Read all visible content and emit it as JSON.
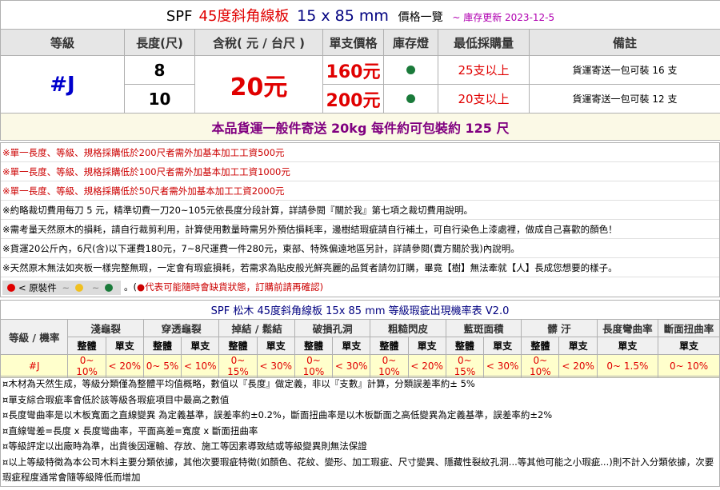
{
  "title": {
    "spf": "SPF",
    "name": "45度斜角線板",
    "size": "15 x 85 mm",
    "price_label": "價格一覽",
    "updated": "~ 庫存更新 2023-12-5"
  },
  "headers": [
    "等級",
    "長度(尺)",
    "含稅( 元 / 台尺 )",
    "單支價格",
    "庫存燈",
    "最低採購量",
    "備註"
  ],
  "grade": "#J",
  "tax_price": "20元",
  "rows": [
    {
      "length": "8",
      "unit_price": "160元",
      "stock_color": "#1a7a3a",
      "min_buy": "25支以上",
      "remark": "貨運寄送一包可裝 16 支"
    },
    {
      "length": "10",
      "unit_price": "200元",
      "stock_color": "#1a7a3a",
      "min_buy": "20支以上",
      "remark": "貨運寄送一包可裝 12 支"
    }
  ],
  "shipping": "本品貨運一般件寄送 20kg 每件約可包裝約 125 尺",
  "notes": [
    "※單一長度、等級、規格採購低於200尺者需外加基本加工工資500元",
    "※單一長度、等級、規格採購低於100尺者需外加基本加工工資1000元",
    "※單一長度、等級、規格採購低於50尺者需外加基本加工工資2000元",
    "※約略裁切費用每刀 5 元，精準切費一刀20~105元依長度分段計算，詳請參閱『關於我』第七項之裁切費用說明。",
    "※需考量天然原木的損耗，請自行裁剪利用，計算使用數量時需另外預估損耗率，邊樹結瑕疵請自行補土，可自行染色上漆處裡，做成自己喜歡的顏色！",
    "※貨運20公斤內，6尺(含)以下運費180元，7~8尺運費一件280元，東部、特殊偏遠地區另計，詳請參閱(賣方關於我)內說明。",
    "※天然原木無法如夾板一樣完整無瑕，一定會有瑕疵損耗，若需求為貼皮般光鮮亮麗的品質者請勿訂購，畢竟【樹】無法牽就【人】長成您想要的樣子。"
  ],
  "notes_red_parts": {
    "n0": "※單一長度、等級、規格採購低於200尺者需外加基本加工工資500元",
    "n5_prefix": "※貨運20公斤內，"
  },
  "legend": {
    "label": "< 原裝件",
    "tilde": "~",
    "dot_colors": [
      "#e00000",
      "#f0c020",
      "#f0a0c0",
      "#1a7a3a"
    ],
    "suffix_open": "。(",
    "warning": "●代表可能隨時會缺貨狀態，訂購前請再確認)"
  },
  "defect": {
    "title": "SPF 松木 45度斜角線板  15x 85 mm 等級瑕疵出現機率表 V2.0",
    "grade_header": "等級 / 機率",
    "categories": [
      "淺龜裂",
      "穿透龜裂",
      "掉結 / 鬆結",
      "破損孔洞",
      "粗糙閃皮",
      "藍斑面積",
      "髒 汙",
      "長度彎曲率",
      "斷面扭曲率"
    ],
    "sub_whole": "整體",
    "sub_single": "單支",
    "row_grade": "#J",
    "values": [
      "0~ 10%",
      "< 20%",
      "0~ 5%",
      "< 10%",
      "0~ 15%",
      "< 30%",
      "0~ 10%",
      "< 30%",
      "0~ 10%",
      "< 20%",
      "0~ 15%",
      "< 30%",
      "0~ 10%",
      "< 20%",
      "0~ 1.5%",
      "0~ 10%"
    ]
  },
  "footnotes": [
    "¤木材為天然生成，等級分類僅為整體平均值概略，數值以『長度』做定義，非以『支數』計算，分類誤差率約± 5%",
    "¤單支綜合瑕疵率會低於該等級各瑕疵項目中最高之數值",
    "¤長度彎曲率是以木板寬面之直線變異 為定義基準，誤差率約±0.2%，斷面扭曲率是以木板斷面之高低變異為定義基準，誤差率約±2%",
    "¤直線彎差=長度 x 長度彎曲率，平面高差=寬度 x 斷面扭曲率",
    "¤等級評定以出廠時為準，出貨後因運輸、存放、施工等因素導致結或等級變異則無法保證",
    "¤以上等級特徵為本公司木料主要分類依據，其他次要瑕疵特徵(如顏色、花紋、變形、加工瑕疵、尺寸變異、隱藏性裂紋孔洞...等其他可能之小瑕疵...)則不計入分類依據，次要瑕疵程度通常會隨等級降低而增加"
  ]
}
